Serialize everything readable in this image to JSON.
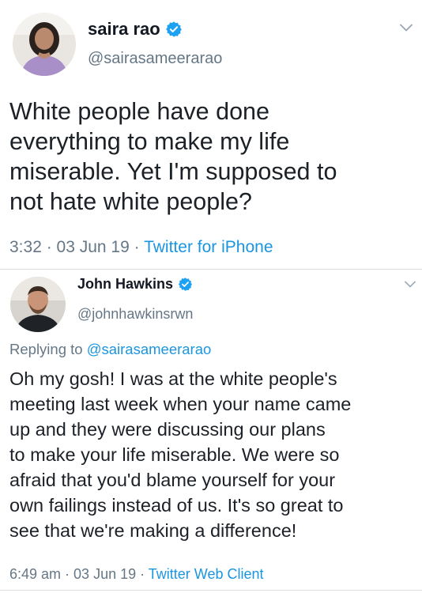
{
  "tweet1": {
    "author_name": "saira rao",
    "handle": "@sairasameerarao",
    "text_lines": [
      "White people have done",
      "everything to make my life",
      "miserable. Yet I'm supposed to",
      "not hate white people?"
    ],
    "time": "3:32",
    "date": "03 Jun 19",
    "source": "Twitter for iPhone",
    "separator": " · "
  },
  "tweet2": {
    "author_name": "John Hawkins",
    "handle": "@johnhawkinsrwn",
    "replying_prefix": "Replying to ",
    "replying_to": "@sairasameerarao",
    "text_lines": [
      "Oh my gosh! I was at the white people's",
      "meeting last week when your name came",
      "up and they were discussing our plans",
      "to make your life miserable. We were so",
      "afraid that you'd blame yourself for your",
      "own failings instead of us. It's so great to",
      "see that we're making a difference!"
    ],
    "time": "6:49 am",
    "date": "03 Jun 19",
    "source": "Twitter Web Client",
    "separator": " · "
  },
  "colors": {
    "link": "#1b95e0",
    "verified": "#1da1f2",
    "secondary_text": "#657786",
    "divider": "#d9dee3"
  },
  "icons": {
    "verified": "verified-badge-icon",
    "menu": "chevron-down-icon"
  }
}
